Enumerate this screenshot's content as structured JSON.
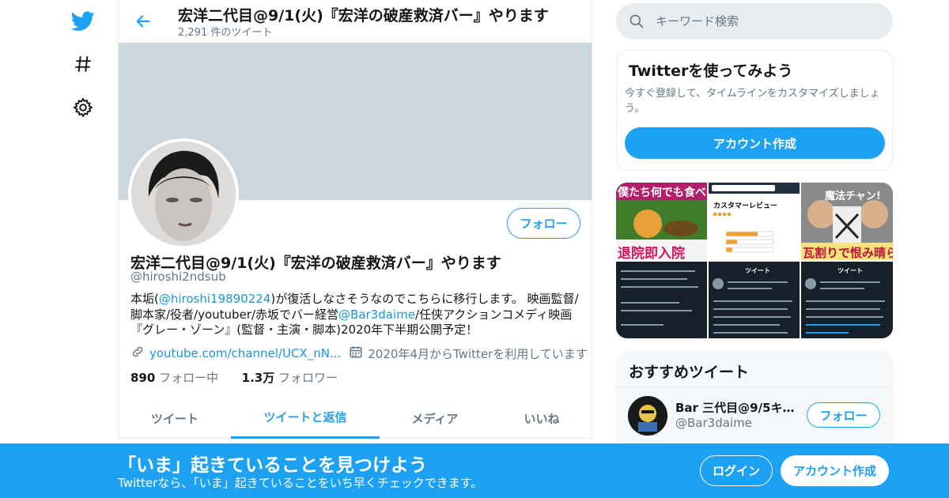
{
  "header": {
    "title": "宏洋二代目@9/1(火)『宏洋の破産救済バー』やります",
    "tweet_count": "2,291 件のツイート"
  },
  "profile": {
    "name": "宏洋二代目@9/1(火)『宏洋の破産救済バー』やります",
    "handle": "@hiroshi2ndsub",
    "follow_label": "フォロー",
    "bio": {
      "part1": "本垢(",
      "mention1": "@hiroshi19890224",
      "part2": ")が復活しなさそうなのでこちらに移行します。 映画監督/脚本家/役者/youtuber/赤坂でバー経営",
      "mention2": "@Bar3daime",
      "part3": "/任侠アクションコメディ映画『グレー・ゾーン』(監督・主演・脚本)2020年下半期公開予定！"
    },
    "website": "youtube.com/channel/UCX_nN...",
    "joined": "2020年4月からTwitterを利用しています",
    "following_count": "890",
    "following_label": "フォロー中",
    "followers_count": "1.3万",
    "followers_label": "フォロワー"
  },
  "tabs": [
    {
      "label": "ツイート",
      "active": false
    },
    {
      "label": "ツイートと返信",
      "active": true
    },
    {
      "label": "メディア",
      "active": false
    },
    {
      "label": "いいね",
      "active": false
    }
  ],
  "search": {
    "placeholder": "キーワード検索"
  },
  "signup_card": {
    "title": "Twitterを使ってみよう",
    "text": "今すぐ登録して、タイムラインをカスタマイズしましょう。",
    "button": "アカウント作成"
  },
  "media_tiles": {
    "tile1_top": "僕たち何でも食べ",
    "tile1_bottom": "退院即入院",
    "tile2_title": "カスタマーレビュー",
    "tile3_top": "魔法チャン!",
    "tile3_bottom": "瓦割りで恨み晴ら",
    "tile4_header": "ツイート",
    "tile5_header": "ツイート"
  },
  "recommended": {
    "title": "おすすめツイート",
    "user_name": "Bar 三代目@9/5キム...",
    "user_handle": "@Bar3daime",
    "follow_label": "フォロー"
  },
  "bottom_bar": {
    "title": "「いま」起きていることを見つけよう",
    "subtitle": "Twitterなら、「いま」起きていることをいち早くチェックできます。",
    "login": "ログイン",
    "signup": "アカウント作成"
  },
  "colors": {
    "brand": "#1da1f2",
    "banner": "#ccd6dd",
    "secondary_text": "#657786"
  },
  "icons": [
    "twitter-bird-icon",
    "hashtag-icon",
    "gear-icon",
    "back-arrow-icon",
    "link-icon",
    "calendar-icon",
    "search-icon"
  ]
}
